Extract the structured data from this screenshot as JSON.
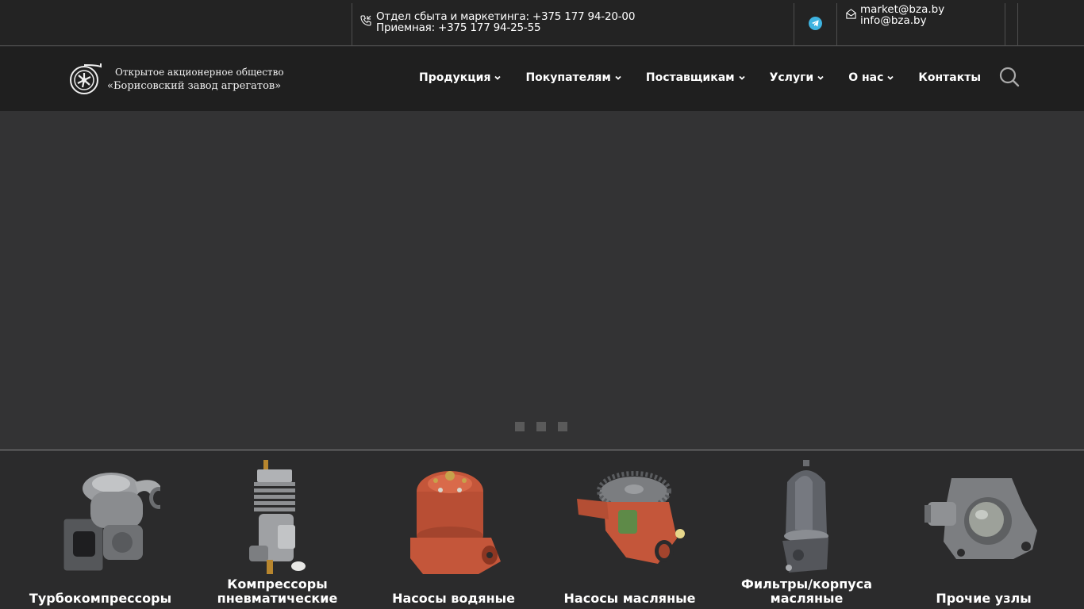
{
  "topbar": {
    "phone_sales": "Отдел сбыта и маркетинга: +375 177 94-20-00",
    "phone_reception": "Приемная: +375 177 94-25-55",
    "email_market": "market@bza.by",
    "email_info": "info@bza.by",
    "telegram_color": "#3eb3e0"
  },
  "header": {
    "logo_line1": "Открытое акционерное общество",
    "logo_line2": "«Борисовский завод агрегатов»",
    "nav": [
      {
        "label": "Продукция",
        "dropdown": true
      },
      {
        "label": "Покупателям",
        "dropdown": true
      },
      {
        "label": "Поставщикам",
        "dropdown": true
      },
      {
        "label": "Услуги",
        "dropdown": true
      },
      {
        "label": "О нас",
        "dropdown": true
      },
      {
        "label": "Контакты",
        "dropdown": false
      }
    ],
    "search_icon": "search-icon"
  },
  "slider": {
    "slide_count": 3,
    "active_index": 0
  },
  "categories": [
    {
      "label": "Турбокомпрессоры",
      "icon": "turbocharger"
    },
    {
      "label": "Компрессоры пневматические",
      "icon": "air-compressor"
    },
    {
      "label": "Насосы водяные",
      "icon": "water-pump"
    },
    {
      "label": "Насосы масляные",
      "icon": "oil-pump"
    },
    {
      "label": "Фильтры/корпуса масляные",
      "icon": "oil-filter"
    },
    {
      "label": "Прочие узлы",
      "icon": "other-units"
    }
  ]
}
